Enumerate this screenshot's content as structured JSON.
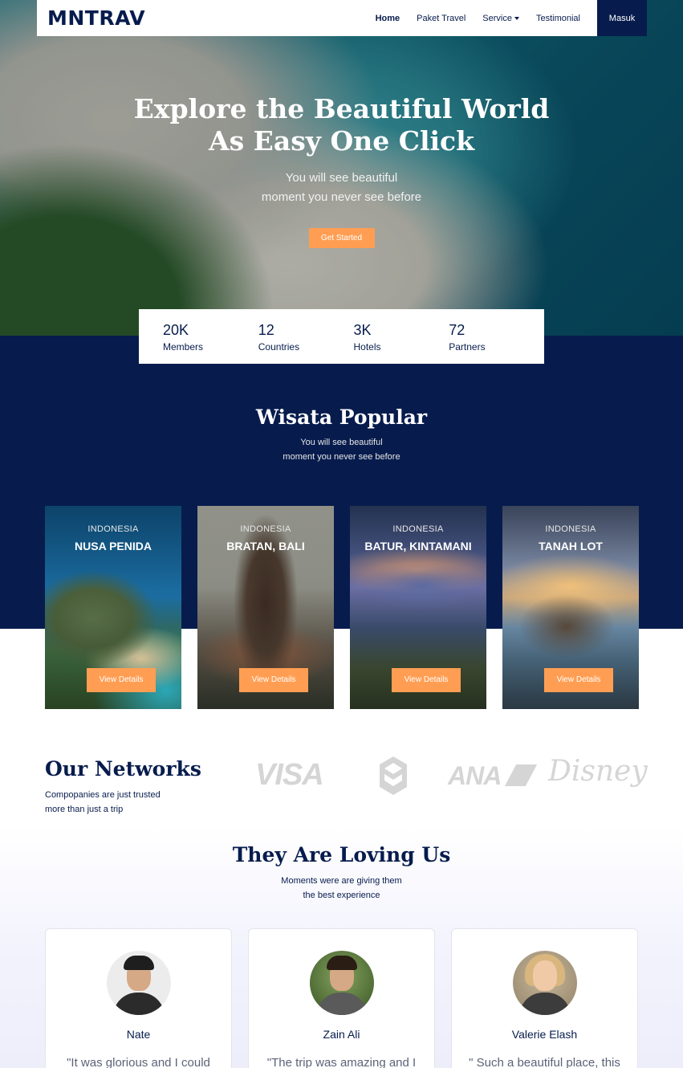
{
  "navbar": {
    "brand": "MNTRAV",
    "links": [
      "Home",
      "Paket Travel",
      "Service",
      "Testimonial"
    ],
    "login": "Masuk"
  },
  "hero": {
    "title_line1": "Explore the Beautiful World",
    "title_line2": "As Easy One Click",
    "sub_line1": "You will see beautiful",
    "sub_line2": "moment you never see before",
    "cta": "Get Started"
  },
  "stats": [
    {
      "value": "20K",
      "label": "Members"
    },
    {
      "value": "12",
      "label": "Countries"
    },
    {
      "value": "3K",
      "label": "Hotels"
    },
    {
      "value": "72",
      "label": "Partners"
    }
  ],
  "popular": {
    "title": "Wisata Popular",
    "sub_line1": "You will see beautiful",
    "sub_line2": "moment you never see before",
    "cards": [
      {
        "country": "INDONESIA",
        "name": "NUSA PENIDA",
        "button": "View Details"
      },
      {
        "country": "INDONESIA",
        "name": "BRATAN, BALI",
        "button": "View Details"
      },
      {
        "country": "INDONESIA",
        "name": "BATUR, KINTAMANI",
        "button": "View Details"
      },
      {
        "country": "INDONESIA",
        "name": "TANAH LOT",
        "button": "View Details"
      }
    ]
  },
  "networks": {
    "title": "Our Networks",
    "sub_line1": "Compopanies are just trusted",
    "sub_line2": "more than just a trip",
    "logos": {
      "visa": "VISA",
      "ana": "ANA",
      "disney": "Disney"
    }
  },
  "testimonials": {
    "title": "They Are Loving Us",
    "sub_line1": "Moments were are giving them",
    "sub_line2": "the best experience",
    "items": [
      {
        "name": "Nate",
        "quote": "\"It was glorious and I could"
      },
      {
        "name": "Zain Ali",
        "quote": "\"The trip was amazing and I"
      },
      {
        "name": "Valerie Elash",
        "quote": "\" Such a beautiful place, this"
      }
    ]
  },
  "colors": {
    "navy": "#071c4d",
    "accent": "#ff9e53"
  }
}
